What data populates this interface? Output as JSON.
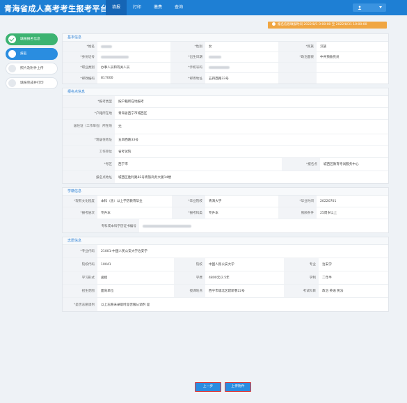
{
  "header": {
    "app_title": "青海省成人高考考生报考平台",
    "nav": [
      "填报",
      "打印",
      "缴费",
      "查询"
    ],
    "active_nav": 0
  },
  "notice": {
    "text": "报名信息填报时间 2022/8/1 0:00:00 至 2022/8/31 10:00:00"
  },
  "steps": [
    {
      "label": "填报报名信息",
      "state": "done"
    },
    {
      "label": "报名",
      "state": "active"
    },
    {
      "label": "照片及附件上传",
      "state": "todo"
    },
    {
      "label": "填报完成并打印",
      "state": "todo"
    }
  ],
  "basic": {
    "title": "基本信息",
    "rows": [
      [
        {
          "label": "*姓名",
          "value": ""
        },
        {
          "label": "*性别",
          "value": "女"
        },
        {
          "label": "*民族",
          "value": "汉族"
        }
      ],
      [
        {
          "label": "*身份证号",
          "value": ""
        },
        {
          "label": "*出生日期",
          "value": ""
        },
        {
          "label": "*政治面貌",
          "value": "中共预备党员"
        }
      ],
      [
        {
          "label": "*职业类别",
          "value": "办事人员和有关人员"
        },
        {
          "label": "*手机号码",
          "value": ""
        },
        {
          "label": "",
          "value": ""
        }
      ],
      [
        {
          "label": "*邮政编码",
          "value": "817000"
        },
        {
          "label": "*邮寄地址",
          "value": "五四西路33号"
        },
        {
          "label": "",
          "value": ""
        }
      ]
    ]
  },
  "apply": {
    "title": "报名点信息",
    "rows": [
      {
        "label": "*报考类型",
        "value": "按户籍所在地报考"
      },
      {
        "label": "*户籍所在地",
        "value": "青海省西宁市城西区"
      },
      {
        "label": "居住证（工作单位）所在地",
        "value": "无"
      },
      {
        "label": "*现居住地址",
        "value": "五四西路33号"
      },
      {
        "label": "工作单位",
        "value": "省考试院"
      }
    ],
    "kaoqu": {
      "label": "*考区",
      "value": "西宁市",
      "label2": "*报名点",
      "value2": "城西区教育考试服务中心"
    },
    "address": {
      "label": "报名点地址",
      "value": "城西区胜利路83号青旅商务大厦14楼"
    }
  },
  "edu": {
    "title": "学籍信息",
    "rows": [
      [
        {
          "label": "*现有文化程度",
          "value": "本科（含）以上学历教育毕业"
        },
        {
          "label": "*毕业院校",
          "value": "青海大学"
        },
        {
          "label": "*毕业时间",
          "value": "20220701"
        }
      ],
      [
        {
          "label": "*报考层次",
          "value": "专升本"
        },
        {
          "label": "*报考科类",
          "value": "专升本"
        },
        {
          "label": "照顾条件",
          "value": "25周岁以上"
        }
      ]
    ],
    "cert_label": "专科或本科学历证书编号"
  },
  "major": {
    "title": "志愿信息",
    "code_label": "*专业代码",
    "code_value": "21001-中国人民公安大学治安学",
    "rows": [
      [
        {
          "label": "院校代码",
          "value": "10041"
        },
        {
          "label": "院校",
          "value": "中国人民公安大学"
        },
        {
          "label": "专业",
          "value": "治安学"
        }
      ],
      [
        {
          "label": "学习形式",
          "value": "函授"
        },
        {
          "label": "学费",
          "value": "4800元/2.5年"
        },
        {
          "label": "学制",
          "value": "二年半"
        }
      ],
      [
        {
          "label": "招生范围",
          "value": "面向单位"
        },
        {
          "label": "授课地点",
          "value": "西宁市城北区建新巷22号"
        },
        {
          "label": "考试科目",
          "value": "政治 英语 民法"
        }
      ]
    ],
    "adjust_label": "*是否志愿调剂",
    "adjust_value": "以上志愿未录取时是否服从调剂 是"
  },
  "footer": {
    "prev": "上一步",
    "next": "上传附件"
  }
}
